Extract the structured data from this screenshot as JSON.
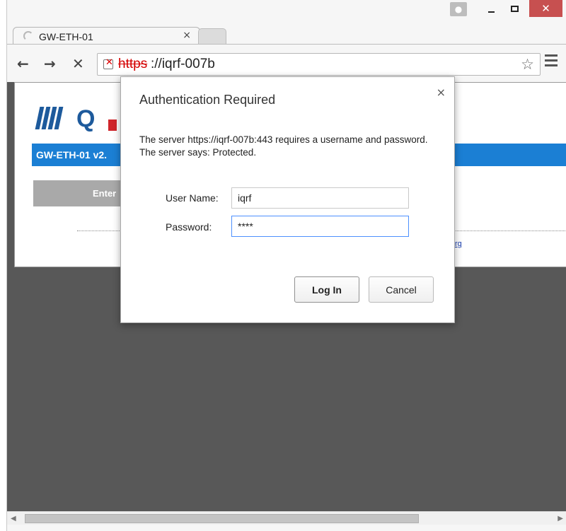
{
  "tab": {
    "title": "GW-ETH-01",
    "close": "×"
  },
  "window_controls": {
    "close": "✕"
  },
  "toolbar": {
    "back": "←",
    "forward": "→",
    "stop": "✕",
    "url_scheme": "https",
    "url_rest": "://iqrf-007b",
    "star": "☆"
  },
  "page": {
    "bar_title": "GW-ETH-01 v2.",
    "enter_button": "Enter",
    "link_fragment": "rg"
  },
  "dialog": {
    "title": "Authentication Required",
    "close": "×",
    "message": "The server https://iqrf-007b:443 requires a username and password. The server says: Protected.",
    "username_label": "User Name:",
    "username_value": "iqrf",
    "password_label": "Password:",
    "password_value": "****",
    "login_button": "Log In",
    "cancel_button": "Cancel"
  },
  "scrollbar": {
    "left_arrow": "◀",
    "right_arrow": "▶"
  }
}
